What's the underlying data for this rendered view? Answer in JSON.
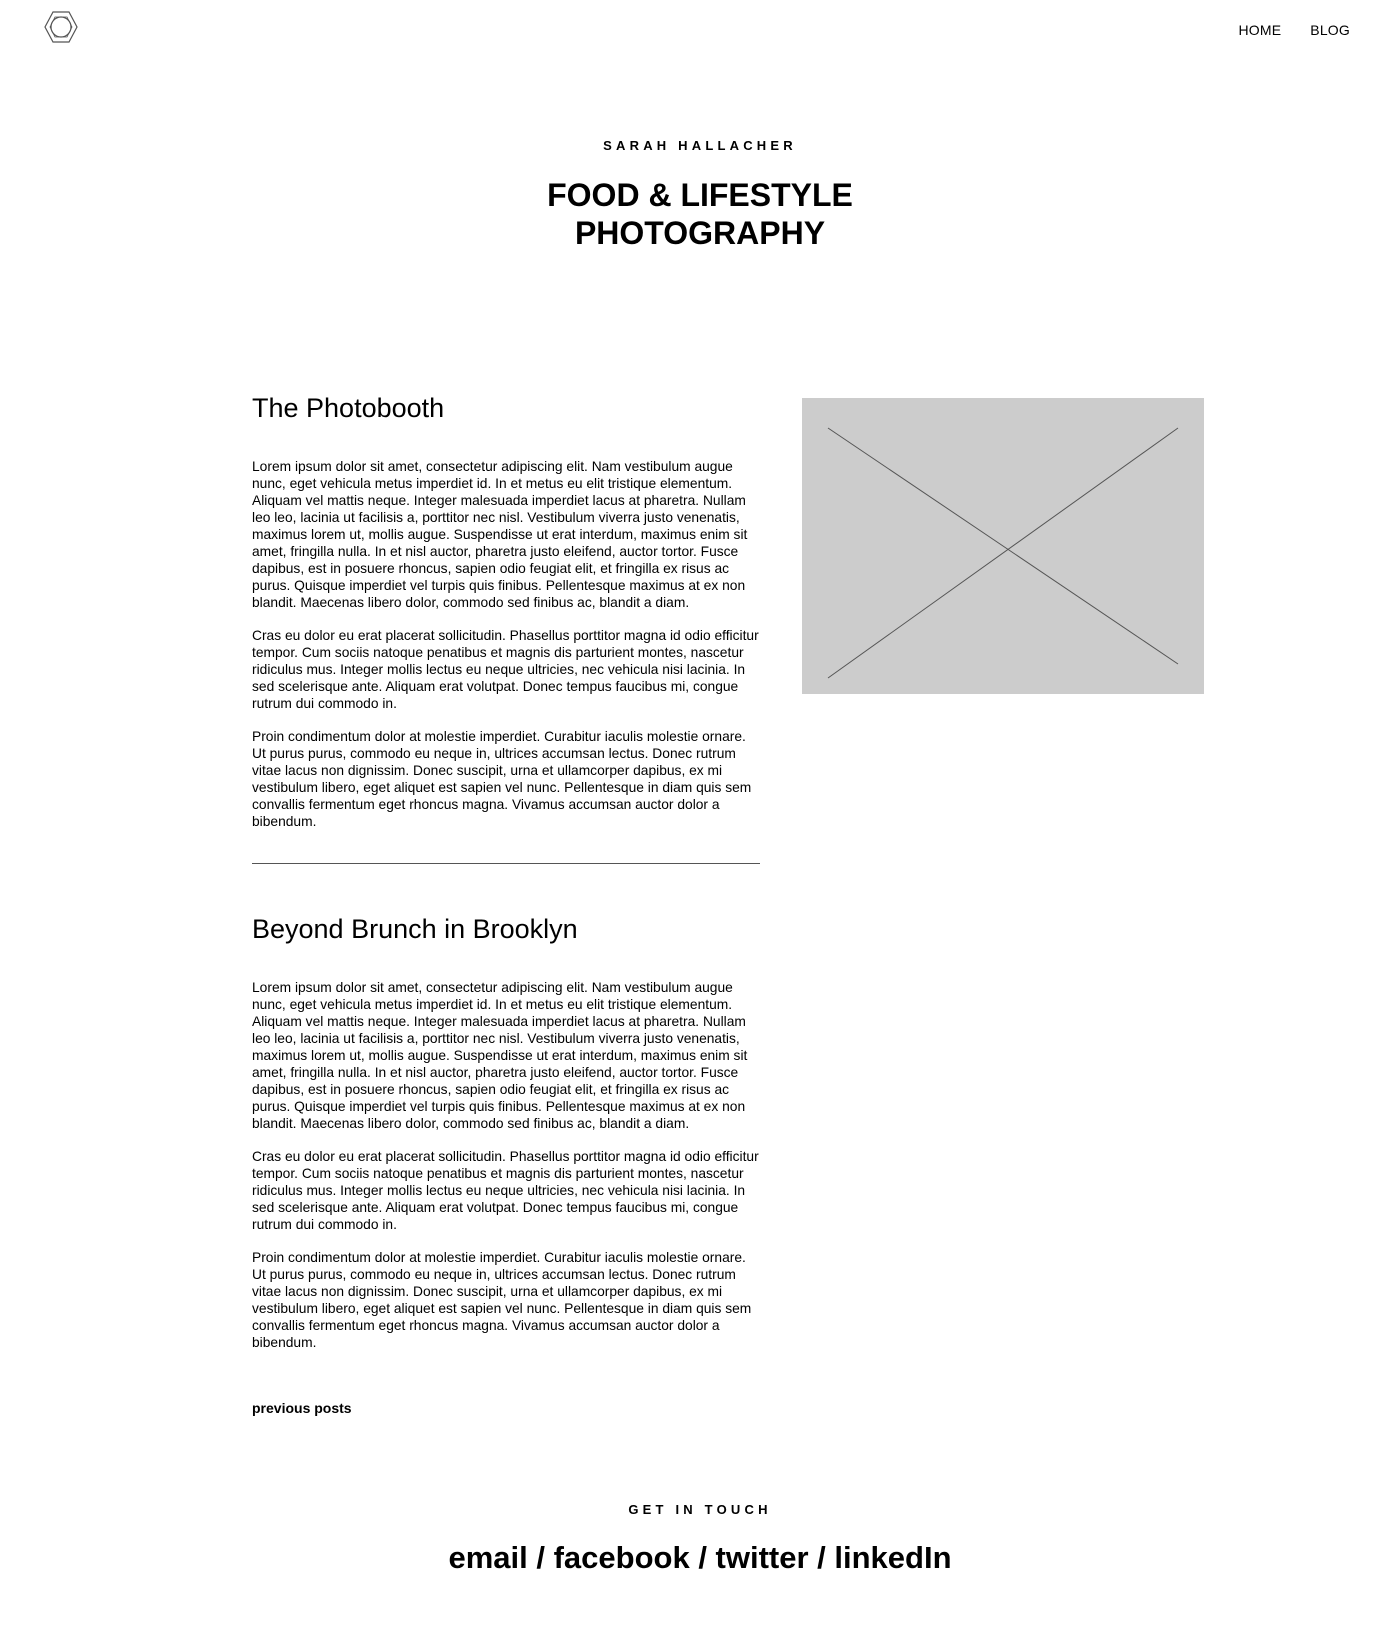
{
  "header": {
    "logo_icon": "aperture-hexagon-icon",
    "nav": [
      {
        "label": "HOME"
      },
      {
        "label": "BLOG"
      }
    ]
  },
  "hero": {
    "name": "SARAH HALLACHER",
    "title_line1": "FOOD & LIFESTYLE",
    "title_line2": "PHOTOGRAPHY"
  },
  "posts": [
    {
      "title": "The Photobooth",
      "paragraphs": [
        "Lorem ipsum dolor sit amet, consectetur adipiscing elit. Nam vestibulum augue nunc, eget vehicula metus imperdiet id. In et metus eu elit tristique elementum. Aliquam vel mattis neque. Integer malesuada imperdiet lacus at pharetra. Nullam leo leo, lacinia ut facilisis a, porttitor nec nisl. Vestibulum viverra justo venenatis, maximus lorem ut, mollis augue. Suspendisse ut erat interdum, maximus enim sit amet, fringilla nulla. In et nisl auctor, pharetra justo eleifend, auctor tortor. Fusce dapibus, est in posuere rhoncus, sapien odio feugiat elit, et fringilla ex risus ac purus. Quisque imperdiet vel turpis quis finibus. Pellentesque maximus at ex non blandit. Maecenas libero dolor, commodo sed finibus ac, blandit a diam.",
        "Cras eu dolor eu erat placerat sollicitudin. Phasellus porttitor magna id odio effici­tur tempor. Cum sociis natoque penatibus et magnis dis parturient montes, nascetur ridiculus mus. Integer mollis lectus eu neque ultricies, nec vehicula nisi lacinia. In sed scelerisque ante. Aliquam erat volutpat. Donec tempus faucibus mi, congue rutrum dui commodo in.",
        "Proin condimentum dolor at molestie imperdiet. Curabitur iaculis molestie ornare. Ut purus purus, commodo eu neque in, ultrices accumsan lectus. Donec rutrum vitae lacus non dignissim. Donec suscipit, urna et ullamcorper dapibus, ex mi vestibulum libero, eget aliquet est sapien vel nunc. Pellentesque in diam quis sem convallis fermentum eget rhoncus magna. Vivamus accumsan auctor dolor a bibendum."
      ]
    },
    {
      "title": "Beyond Brunch in Brooklyn",
      "paragraphs": [
        "Lorem ipsum dolor sit amet, consectetur adipiscing elit. Nam vestibulum augue nunc, eget vehicula metus imperdiet id. In et metus eu elit tristique elementum. Aliquam vel mattis neque. Integer malesuada imperdiet lacus at pharetra. Nullam leo leo, lacinia ut facilisis a, porttitor nec nisl. Vestibulum viverra justo venenatis, maximus lorem ut, mollis augue. Suspendisse ut erat interdum, maximus enim sit amet, fringilla nulla. In et nisl auctor, pharetra justo eleifend, auctor tortor. Fusce dapibus, est in posuere rhoncus, sapien odio feugiat elit, et fringilla ex risus ac purus. Quisque imperdiet vel turpis quis finibus. Pellentesque maximus at ex non blandit. Maecenas libero dolor, commodo sed finibus ac, blandit a diam.",
        "Cras eu dolor eu erat placerat sollicitudin. Phasellus porttitor magna id odio effici­tur tempor. Cum sociis natoque penatibus et magnis dis parturient montes, nascetur ridiculus mus. Integer mollis lectus eu neque ultricies, nec vehicula nisi lacinia. In sed scelerisque ante. Aliquam erat volutpat. Donec tempus faucibus mi, congue rutrum dui commodo in.",
        "Proin condimentum dolor at molestie imperdiet. Curabitur iaculis molestie ornare. Ut purus purus, commodo eu neque in, ultrices accumsan lectus. Donec rutrum vitae lacus non dignissim. Donec suscipit, urna et ullamcorper dapibus, ex mi vestibulum libero, eget aliquet est sapien vel nunc. Pellentesque in diam quis sem convallis fermentum eget rhoncus magna. Vivamus accumsan auctor dolor a bibendum."
      ]
    }
  ],
  "pagination": {
    "previous_label": "previous posts"
  },
  "footer": {
    "label": "GET IN TOUCH",
    "links": [
      "email",
      "facebook",
      "twitter",
      "linkedIn"
    ],
    "separator": " / "
  },
  "colors": {
    "placeholder_bg": "#cccccc",
    "placeholder_lines": "#555555"
  }
}
